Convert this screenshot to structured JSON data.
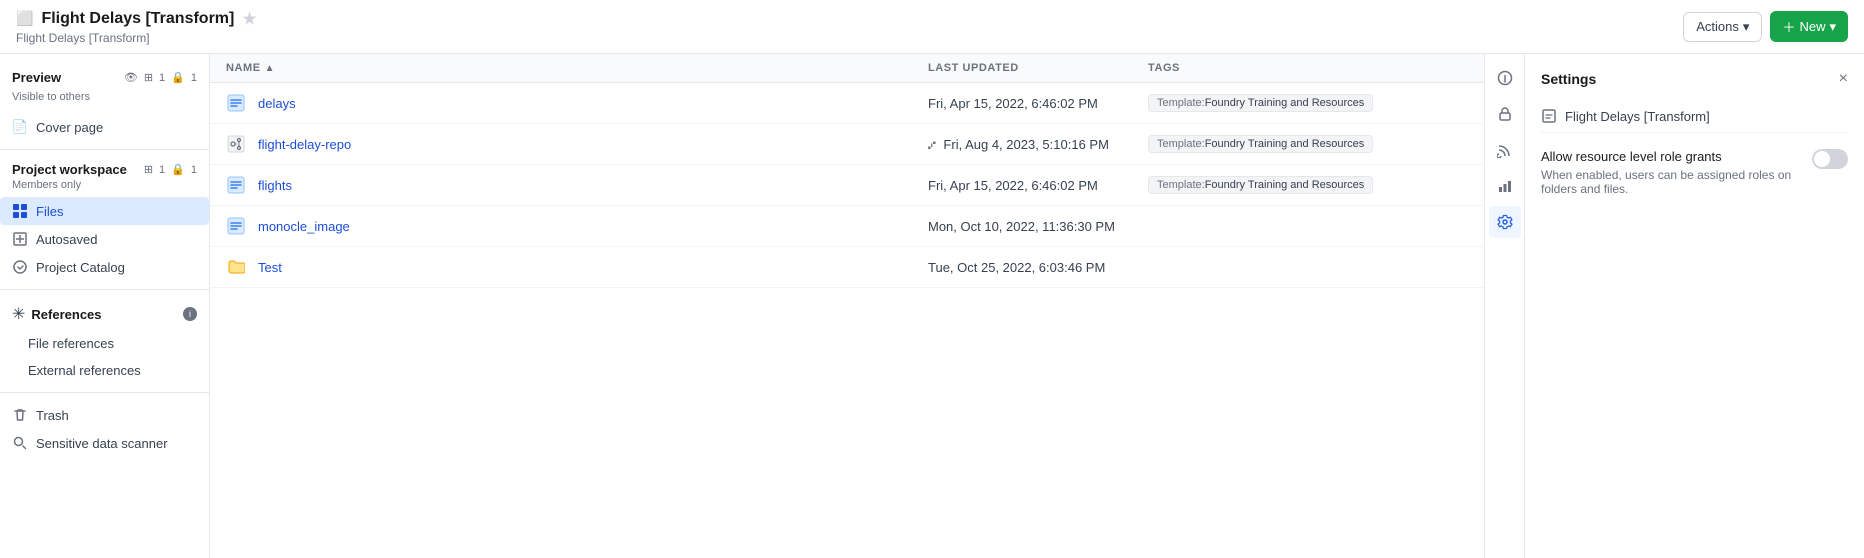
{
  "header": {
    "title": "Flight Delays [Transform]",
    "subtitle": "Flight Delays [Transform]",
    "star_icon": "★",
    "window_icon": "⬜",
    "actions_label": "Actions",
    "new_label": "New"
  },
  "sidebar": {
    "preview": {
      "title": "Preview",
      "visible_label": "Visible to others",
      "eye_icon": "👁",
      "table_count": "1",
      "lock_count": "1"
    },
    "cover_page": "Cover page",
    "workspace": {
      "title": "Project workspace",
      "subtitle": "Members only",
      "table_count": "1",
      "lock_count": "1"
    },
    "items": [
      {
        "label": "Files",
        "active": true
      },
      {
        "label": "Autosaved",
        "active": false
      },
      {
        "label": "Project Catalog",
        "active": false
      }
    ],
    "references": {
      "label": "References",
      "sub_items": [
        {
          "label": "File references"
        },
        {
          "label": "External references"
        }
      ]
    },
    "trash": "Trash",
    "sensitive_data_scanner": "Sensitive data scanner"
  },
  "table": {
    "columns": {
      "name": "NAME",
      "last_updated": "LAST UPDATED",
      "tags": "TAGS"
    },
    "rows": [
      {
        "name": "delays",
        "icon_type": "dataset",
        "last_updated": "Fri, Apr 15, 2022, 6:46:02 PM",
        "tag": "Template: Foundry Training and Resources"
      },
      {
        "name": "flight-delay-repo",
        "icon_type": "repo",
        "last_updated": "Fri, Aug 4, 2023, 5:10:16 PM",
        "tag": "Template: Foundry Training and Resources"
      },
      {
        "name": "flights",
        "icon_type": "dataset",
        "last_updated": "Fri, Apr 15, 2022, 6:46:02 PM",
        "tag": "Template: Foundry Training and Resources"
      },
      {
        "name": "monocle_image",
        "icon_type": "dataset",
        "last_updated": "Mon, Oct 10, 2022, 11:36:30 PM",
        "tag": ""
      },
      {
        "name": "Test",
        "icon_type": "folder",
        "last_updated": "Tue, Oct 25, 2022, 6:03:46 PM",
        "tag": ""
      }
    ]
  },
  "right_panel": {
    "settings_title": "Settings",
    "close_icon": "×",
    "item_name": "Flight Delays [Transform]",
    "option_title": "Allow resource level role grants",
    "option_description": "When enabled, users can be assigned roles on folders and files."
  }
}
